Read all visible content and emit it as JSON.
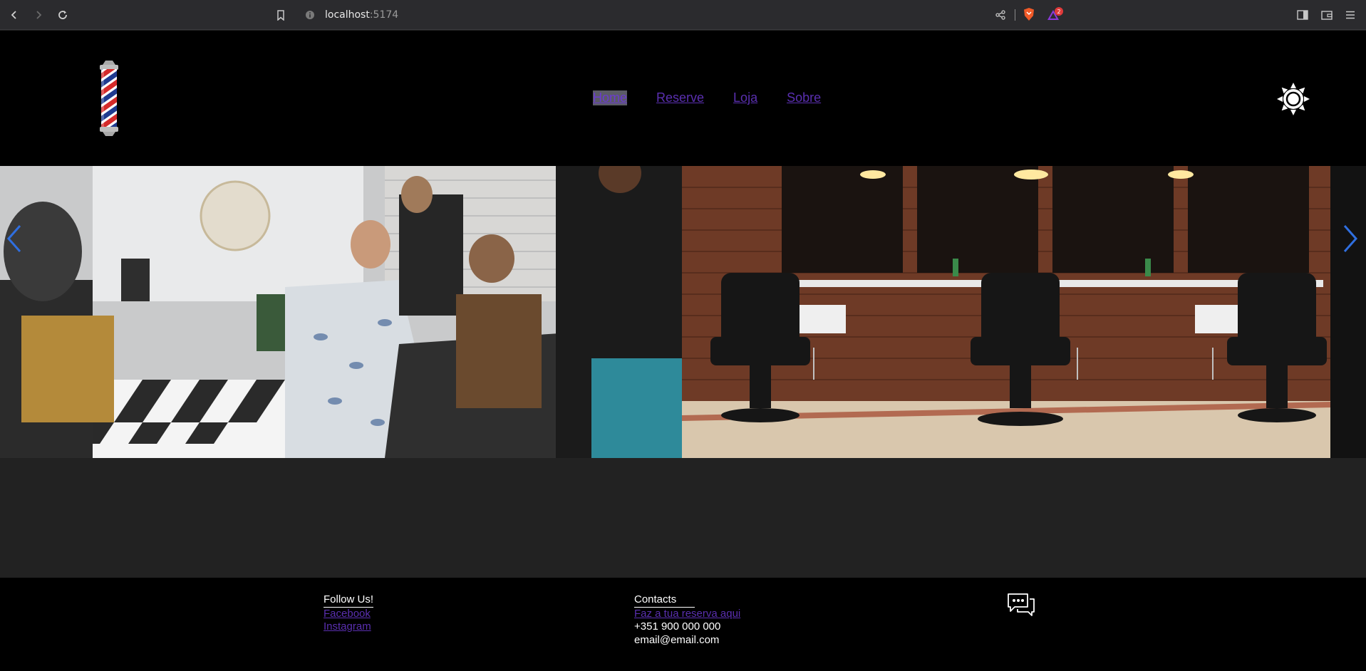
{
  "browser": {
    "url_host": "localhost",
    "url_port": ":5174",
    "notification_count": "2"
  },
  "nav": {
    "items": [
      {
        "label": "Home",
        "active": true
      },
      {
        "label": "Reserve",
        "active": false
      },
      {
        "label": "Loja",
        "active": false
      },
      {
        "label": "Sobre",
        "active": false
      }
    ]
  },
  "icons": {
    "logo": "barber-pole-icon",
    "theme": "sun-icon",
    "prev": "chevron-left-icon",
    "next": "chevron-right-icon",
    "chat": "chat-bubbles-icon"
  },
  "footer": {
    "follow": {
      "title": "Follow Us!",
      "links": [
        "Facebook",
        "Instagram"
      ]
    },
    "contacts": {
      "title": "Contacts",
      "booking_link": "Faz a tua reserva aqui",
      "phone": "+351 900 000 000",
      "email": "email@email.com"
    }
  },
  "colors": {
    "header_bg": "#000000",
    "page_bg": "#222222",
    "link": "#5a2fb0",
    "carousel_arrow": "#2f6fe0"
  }
}
